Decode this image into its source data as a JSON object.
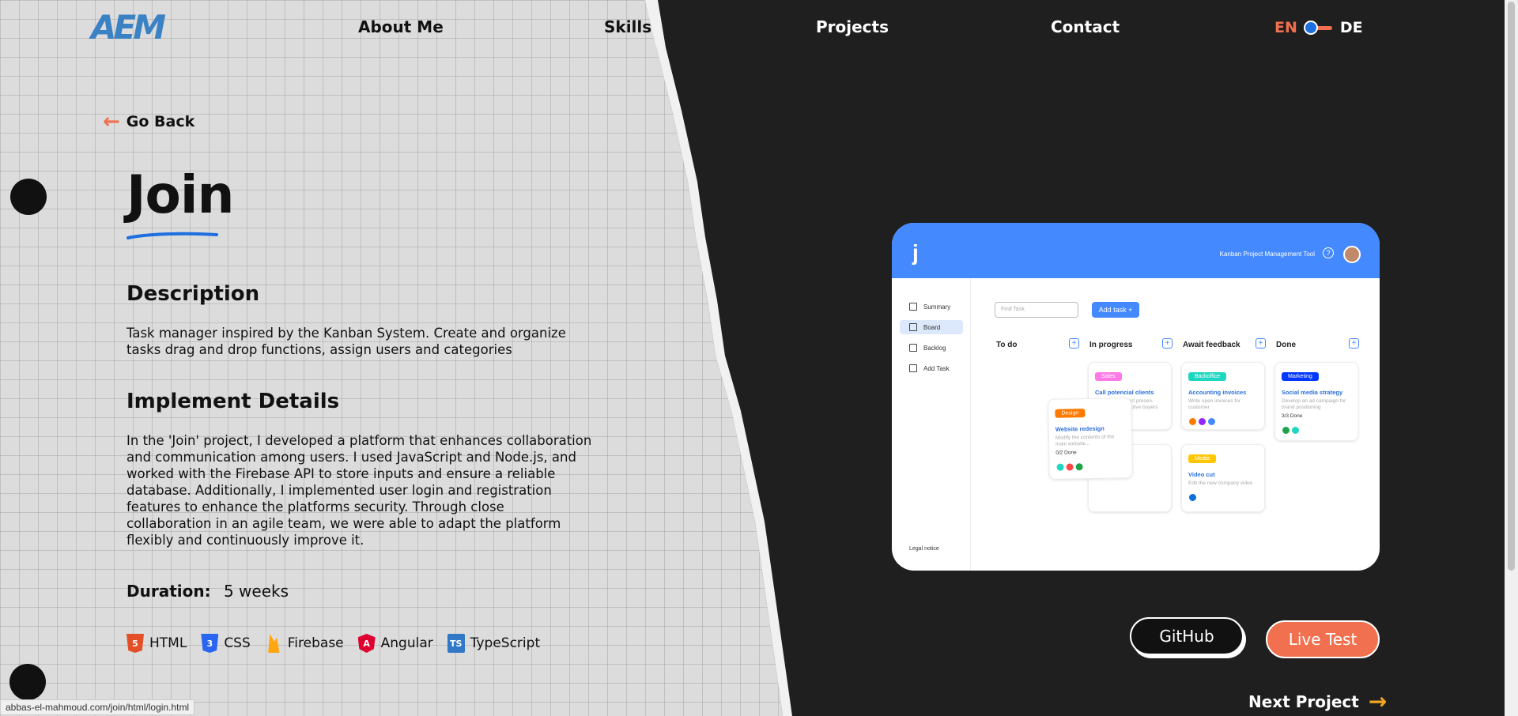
{
  "nav": {
    "logo": "AEM",
    "items": [
      "About Me",
      "Skills",
      "Projects",
      "Contact"
    ],
    "lang_en": "EN",
    "lang_de": "DE"
  },
  "go_back": "Go Back",
  "project": {
    "title": "Join",
    "description_heading": "Description",
    "description": "Task manager inspired by the Kanban System. Create and organize tasks drag and drop functions, assign users and categories",
    "implement_heading": "Implement Details",
    "implement": "In the 'Join' project, I developed a platform that enhances collaboration and communication among users. I used JavaScript and Node.js, and worked with the Firebase API to store inputs and ensure a reliable database. Additionally, I implemented user login and registration features to enhance the platforms security. Through close collaboration in an agile team, we were able to adapt the platform flexibly and continuously improve it.",
    "duration_label": "Duration:",
    "duration_value": "5 weeks",
    "technologies": [
      {
        "name": "HTML",
        "icon": "html5-icon",
        "color": "#e34f26"
      },
      {
        "name": "CSS",
        "icon": "css3-icon",
        "color": "#2965f1"
      },
      {
        "name": "Firebase",
        "icon": "firebase-icon",
        "color": "#ffa611"
      },
      {
        "name": "Angular",
        "icon": "angular-icon",
        "color": "#dd0031"
      },
      {
        "name": "TypeScript",
        "icon": "typescript-icon",
        "color": "#3178c6"
      }
    ]
  },
  "preview": {
    "header_text": "Kanban Project Management Tool",
    "sidebar": [
      "Summary",
      "Board",
      "Backlog",
      "Add Task"
    ],
    "legal": "Legal notice",
    "find_placeholder": "Find Task",
    "add_task": "Add task +",
    "columns": [
      "To do",
      "In progress",
      "Await feedback",
      "Done"
    ],
    "cards": [
      {
        "tag": "Sales",
        "tag_color": "#ff7ae6",
        "title": "Call potencial clients",
        "desc": "Make the product presen- tation to prospective buyers"
      },
      {
        "tag": "Backoffice",
        "tag_color": "#1fd7c1",
        "title": "Accounting invoices",
        "desc": "Write open invoices for customer"
      },
      {
        "tag": "Marketing",
        "tag_color": "#0038ff",
        "title": "Social media strategy",
        "desc": "Develop an ad campaign for brand positioning",
        "progress": "3/3 Done"
      },
      {
        "tag": "Design",
        "tag_color": "#ff7a00",
        "title": "Website redesign",
        "desc": "Modify the contents of the main website...",
        "progress": "0/2 Done"
      },
      {
        "tag": "Media",
        "tag_color": "#ffc701",
        "title": "Video cut",
        "desc": "Edit the new company video"
      }
    ]
  },
  "buttons": {
    "github": "GitHub",
    "live_test": "Live Test",
    "next_project": "Next Project"
  },
  "status_url": "abbas-el-mahmoud.com/join/html/login.html",
  "colors": {
    "accent": "#f0704f",
    "brand_blue": "#3b82c4",
    "dark_bg": "#1f1f1f",
    "next_arrow": "#f5a623"
  }
}
